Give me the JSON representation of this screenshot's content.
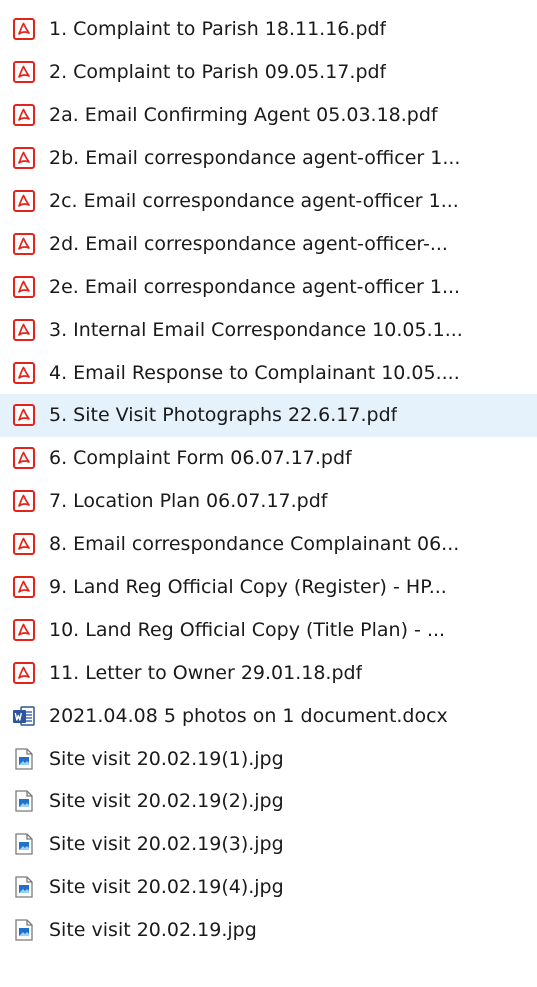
{
  "files": [
    {
      "name": "1. Complaint to Parish 18.11.16.pdf",
      "icon": "pdf-icon"
    },
    {
      "name": "2. Complaint to Parish 09.05.17.pdf",
      "icon": "pdf-icon"
    },
    {
      "name": "2a. Email Confirming Agent 05.03.18.pdf",
      "icon": "pdf-icon"
    },
    {
      "name": "2b. Email correspondance agent-officer 1...",
      "icon": "pdf-icon"
    },
    {
      "name": "2c. Email correspondance agent-officer 1...",
      "icon": "pdf-icon"
    },
    {
      "name": "2d. Email correspondance agent-officer-...",
      "icon": "pdf-icon"
    },
    {
      "name": "2e. Email correspondance agent-officer 1...",
      "icon": "pdf-icon"
    },
    {
      "name": "3. Internal Email Correspondance 10.05.1...",
      "icon": "pdf-icon"
    },
    {
      "name": "4. Email Response to Complainant 10.05....",
      "icon": "pdf-icon"
    },
    {
      "name": "5. Site Visit Photographs 22.6.17.pdf",
      "icon": "pdf-icon",
      "selected": true
    },
    {
      "name": "6. Complaint Form 06.07.17.pdf",
      "icon": "pdf-icon"
    },
    {
      "name": "7. Location Plan 06.07.17.pdf",
      "icon": "pdf-icon"
    },
    {
      "name": "8. Email correspondance Complainant 06...",
      "icon": "pdf-icon"
    },
    {
      "name": "9. Land Reg Official Copy (Register) - HP...",
      "icon": "pdf-icon"
    },
    {
      "name": "10. Land Reg Official Copy (Title Plan) - ...",
      "icon": "pdf-icon"
    },
    {
      "name": "11. Letter to Owner 29.01.18.pdf",
      "icon": "pdf-icon"
    },
    {
      "name": "2021.04.08 5 photos on 1 document.docx",
      "icon": "word-document-icon"
    },
    {
      "name": "Site visit 20.02.19(1).jpg",
      "icon": "image-file-icon"
    },
    {
      "name": "Site visit 20.02.19(2).jpg",
      "icon": "image-file-icon"
    },
    {
      "name": "Site visit 20.02.19(3).jpg",
      "icon": "image-file-icon"
    },
    {
      "name": "Site visit 20.02.19(4).jpg",
      "icon": "image-file-icon"
    },
    {
      "name": "Site visit 20.02.19.jpg",
      "icon": "image-file-icon"
    }
  ],
  "colors": {
    "pdf_red": "#e1251b",
    "word_blue": "#2b579a",
    "selection": "#e5f1fb",
    "text": "#1a1a1a"
  }
}
